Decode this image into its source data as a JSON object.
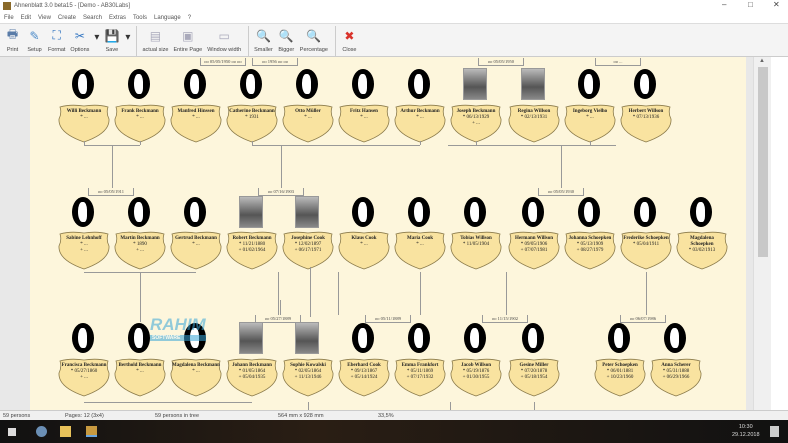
{
  "window": {
    "title": "Ahnenblatt 3.0 beta15 - [Demo - AB30Labs]",
    "controls": [
      "–",
      "□",
      "✕"
    ]
  },
  "menu": [
    "File",
    "Edit",
    "View",
    "Create",
    "Search",
    "Extras",
    "Tools",
    "Language",
    "?"
  ],
  "toolbar": [
    {
      "label": "Print",
      "icon": "printer-icon",
      "glyph": "🖶",
      "color": "#5a7ca8"
    },
    {
      "label": "Setup",
      "icon": "page-setup-icon",
      "glyph": "✎",
      "color": "#4b8ac8"
    },
    {
      "label": "Format",
      "icon": "format-icon",
      "glyph": "⛶",
      "color": "#2f73c0"
    },
    {
      "label": "Options",
      "icon": "tools-icon",
      "glyph": "✂",
      "color": "#2f73c0"
    },
    {
      "label": "Save",
      "icon": "save-icon",
      "glyph": "💾",
      "color": "#2f73c0"
    },
    {
      "label": "actual size",
      "icon": "actual-size-icon",
      "glyph": "▤",
      "color": "#aab"
    },
    {
      "label": "Entire Page",
      "icon": "entire-page-icon",
      "glyph": "▣",
      "color": "#aab"
    },
    {
      "label": "Window width",
      "icon": "window-width-icon",
      "glyph": "▭",
      "color": "#aab"
    },
    {
      "label": "Smaller",
      "icon": "zoom-out-icon",
      "glyph": "🔍",
      "color": "#3a9fd0"
    },
    {
      "label": "Bigger",
      "icon": "zoom-in-icon",
      "glyph": "🔍",
      "color": "#3a9fd0"
    },
    {
      "label": "Percentage",
      "icon": "zoom-percent-icon",
      "glyph": "🔍",
      "color": "#3a9fd0"
    },
    {
      "label": "Close",
      "icon": "close-icon",
      "glyph": "✖",
      "color": "#d9332b"
    }
  ],
  "rows": [
    [
      {
        "name": "Willi Beckmann",
        "dates": [
          "* ..."
        ]
      },
      {
        "name": "Frank Beckmann",
        "dates": [
          "* ..."
        ]
      },
      {
        "name": "Manfred Hinssen",
        "dates": [
          "* ..."
        ]
      },
      {
        "name": "Catherine Beckmann",
        "dates": [
          "* 1931"
        ]
      },
      {
        "name": "Otto Müller",
        "dates": [
          "* ..."
        ]
      },
      {
        "name": "Fritz Hansen",
        "dates": [
          "* ..."
        ]
      },
      {
        "name": "Arthur Beckmann",
        "dates": [
          "* ..."
        ]
      },
      {
        "name": "Joseph Beckmann",
        "dates": [
          "* 06/13/1929",
          "+ ..."
        ],
        "photo": true
      },
      {
        "name": "Regina Willson",
        "dates": [
          "* 02/13/1931"
        ],
        "photo": true
      },
      {
        "name": "Ingeborg Vielho",
        "dates": [
          "* ..."
        ]
      },
      {
        "name": "Herbert Willson",
        "dates": [
          "* 07/13/1936"
        ]
      }
    ],
    [
      {
        "name": "Sabine Lehnhoff",
        "dates": [
          "* ...",
          "+ ..."
        ]
      },
      {
        "name": "Martin Beckmann",
        "dates": [
          "* 1890",
          "+ ..."
        ]
      },
      {
        "name": "Gertrud Beckmann",
        "dates": [
          "* ..."
        ]
      },
      {
        "name": "Robert Beckmann",
        "dates": [
          "* 11/21/1880",
          "+ 01/02/1964"
        ],
        "photo": true
      },
      {
        "name": "Josephine Cook",
        "dates": [
          "* 12/02/1897",
          "+ 06/17/1971"
        ],
        "photo": true
      },
      {
        "name": "Klaus Cook",
        "dates": [
          "* ..."
        ]
      },
      {
        "name": "Maria Cook",
        "dates": [
          "* ..."
        ]
      },
      {
        "name": "Tobias Willson",
        "dates": [
          "* 11/05/1904"
        ]
      },
      {
        "name": "Hermann Willson",
        "dates": [
          "* 09/05/1906",
          "+ 07/07/1981"
        ]
      },
      {
        "name": "Johanna Schoepken",
        "dates": [
          "* 05/13/1909",
          "+ 08/27/1979"
        ]
      },
      {
        "name": "Frederike Schoepken",
        "dates": [
          "* 05/04/1911"
        ]
      },
      {
        "name": "Magdalena Schoepken",
        "dates": [
          "* 03/02/1913"
        ]
      }
    ],
    [
      {
        "name": "Francisca Beckmann",
        "dates": [
          "* 05/27/1860",
          "+ ..."
        ]
      },
      {
        "name": "Berthold Beckmann",
        "dates": [
          "* ..."
        ]
      },
      {
        "name": "Magdalena Beckmann",
        "dates": [
          "* ..."
        ]
      },
      {
        "name": "Johann Beckmann",
        "dates": [
          "* 01/05/1864",
          "+ 05/04/1935"
        ],
        "photo": true
      },
      {
        "name": "Sophie Kowalski",
        "dates": [
          "* 02/05/1864",
          "+ 11/13/1946"
        ],
        "photo": true
      },
      {
        "name": "Eberhard Cook",
        "dates": [
          "* 09/13/1867",
          "+ 05/14/1924"
        ]
      },
      {
        "name": "Emma Frankfort",
        "dates": [
          "* 05/11/1869",
          "+ 07/17/1932"
        ]
      },
      {
        "name": "Jacob Willson",
        "dates": [
          "* 05/19/1876",
          "+ 01/30/1955"
        ]
      },
      {
        "name": "Gesine Miller",
        "dates": [
          "* 07/20/1878",
          "+ 05/18/1954"
        ]
      },
      {
        "name": "Peter Schoepken",
        "dates": [
          "* 06/01/1881",
          "+ 10/23/1960"
        ]
      },
      {
        "name": "Anna Scherer",
        "dates": [
          "* 05/31/1888",
          "+ 06/29/1966"
        ]
      }
    ]
  ],
  "marriages": [
    [
      "oo 05/05/1950 oo oo",
      "oo 1956 oo oo",
      "oo 05/05/1950",
      "oo ..."
    ],
    [
      "oo 05/05/1911",
      "oo 07/16/1903",
      "oo 05/05/1930"
    ],
    [
      "oo 05/27/1889",
      "oo 05/11/1889",
      "oo 11/15/1902",
      "oo 06/07/1986"
    ]
  ],
  "watermark": {
    "text": "RAHIM",
    "sub": "SOFTWARE"
  },
  "status": {
    "persons": "59 persons",
    "pages": "Pages: 12 (3x4)",
    "in_tree": "59 persons in tree",
    "size": "564 mm x 928 mm",
    "zoom": "33,5%"
  },
  "taskbar": {
    "time": "10:30",
    "date": "29.12.2018"
  },
  "colors": {
    "paper": "#fdf6dc",
    "shield": "#f9e3a0"
  }
}
